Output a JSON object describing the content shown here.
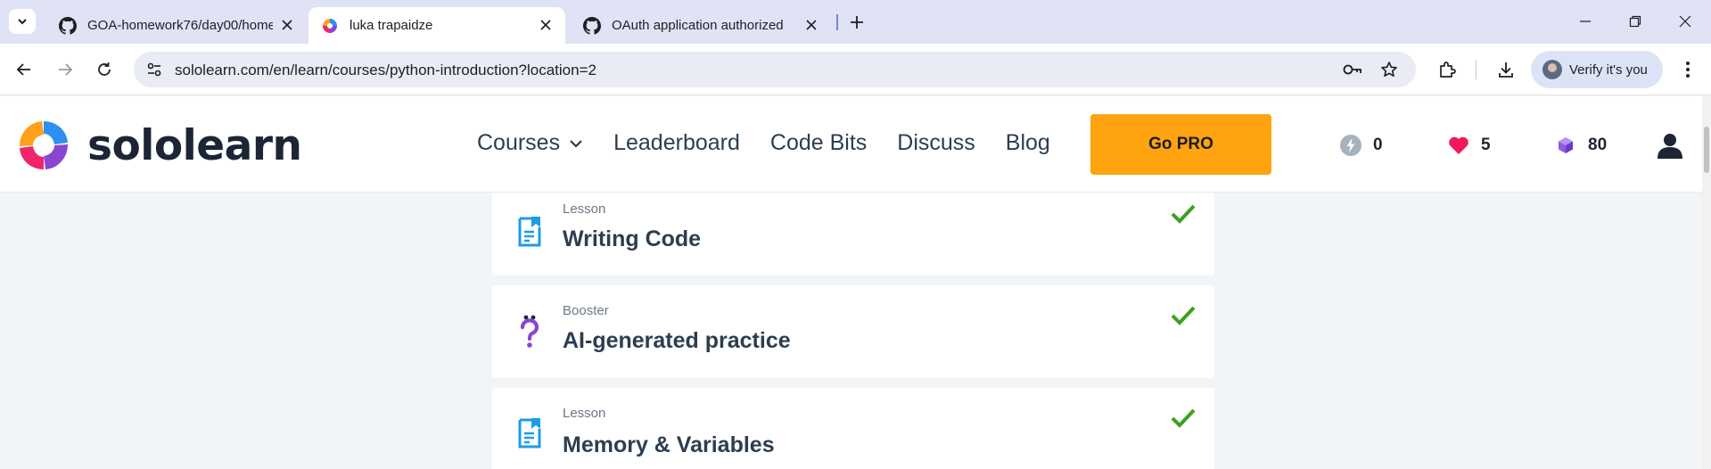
{
  "browser": {
    "tabs": [
      {
        "title": "GOA-homework76/day00/home",
        "favicon": "github-icon",
        "active": false
      },
      {
        "title": "luka trapaidze",
        "favicon": "sololearn-icon",
        "active": true
      },
      {
        "title": "OAuth application authorized",
        "favicon": "github-icon",
        "active": false
      }
    ],
    "url": "sololearn.com/en/learn/courses/python-introduction?location=2",
    "profile_label": "Verify it's you"
  },
  "header": {
    "brand": "sololearn",
    "nav": [
      "Courses",
      "Leaderboard",
      "Code Bits",
      "Discuss",
      "Blog"
    ],
    "cta": "Go PRO",
    "stats": {
      "streak": "0",
      "hearts": "5",
      "bits": "80"
    }
  },
  "lessons": [
    {
      "type": "Lesson",
      "title": "Writing Code",
      "icon": "lesson-doc-icon",
      "completed": true
    },
    {
      "type": "Booster",
      "title": "AI-generated practice",
      "icon": "question-mark-icon",
      "completed": true
    },
    {
      "type": "Lesson",
      "title": "Memory & Variables",
      "icon": "lesson-doc-icon",
      "completed": true
    }
  ],
  "colors": {
    "accent": "#ffa310",
    "lesson_icon": "#1e9be9",
    "booster_icon": "#8a45d1",
    "check": "#3aa11f",
    "heart": "#f2185a",
    "bits": "#8d5be0"
  }
}
